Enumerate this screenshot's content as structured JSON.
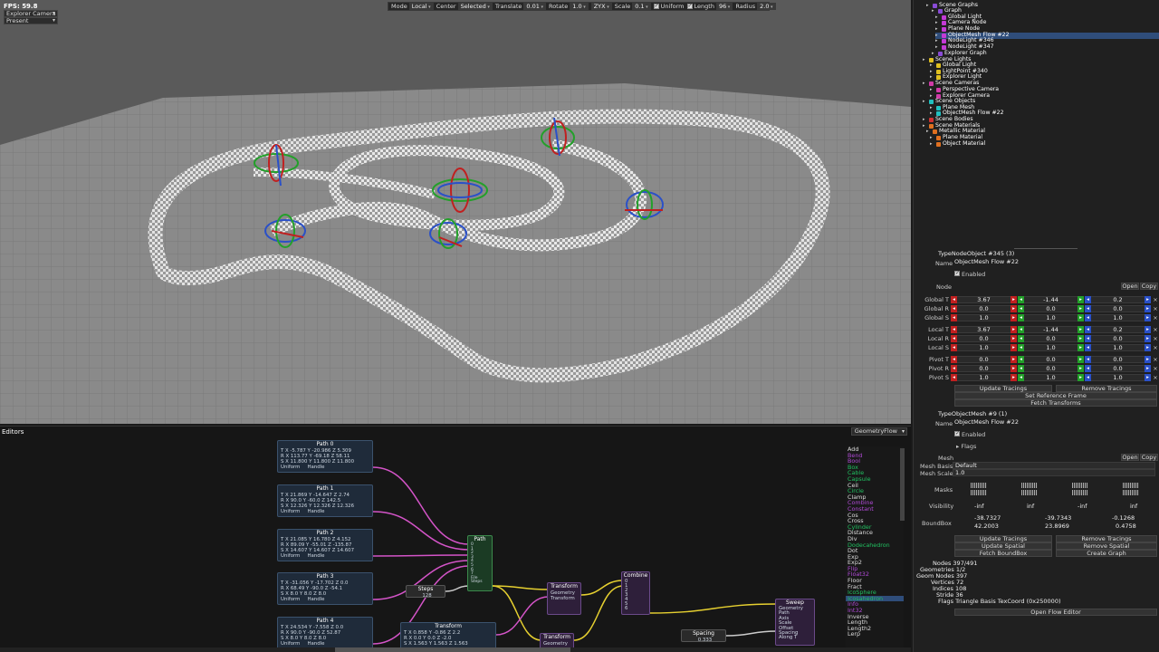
{
  "viewport": {
    "fps": "FPS: 59.8",
    "camera_select": "Explorer Camera",
    "mode_select": "Present",
    "toolbar": {
      "mode_label": "Mode",
      "mode_value": "Local",
      "center_label": "Center",
      "center_value": "Selected",
      "translate_label": "Translate",
      "translate_value": "0.01",
      "rotate_label": "Rotate",
      "rotate_value": "1.0",
      "order_value": "ZYX",
      "scale_label": "Scale",
      "scale_value": "0.1",
      "uniform_label": "Uniform",
      "length_label": "Length",
      "length_value": "96",
      "radius_label": "Radius",
      "radius_value": "2.0"
    }
  },
  "scene_tree": [
    {
      "label": "Scene Graphs",
      "icon": "graph-icon",
      "color": "#8a4bd6"
    },
    {
      "label": "Graph",
      "icon": "graph-icon",
      "color": "#8a4bd6"
    },
    {
      "label": "Global Light",
      "icon": "node-icon",
      "color": "#c43ad6"
    },
    {
      "label": "Camera Node",
      "icon": "node-icon",
      "color": "#c43ad6"
    },
    {
      "label": "Plane Node",
      "icon": "node-icon",
      "color": "#c43ad6"
    },
    {
      "label": "ObjectMesh Flow #22",
      "icon": "node-icon",
      "color": "#c43ad6",
      "selected": true
    },
    {
      "label": "NodeLight #346",
      "icon": "node-icon",
      "color": "#c43ad6"
    },
    {
      "label": "NodeLight #347",
      "icon": "node-icon",
      "color": "#c43ad6"
    },
    {
      "label": "Explorer Graph",
      "icon": "graph-icon",
      "color": "#8a4bd6"
    },
    {
      "label": "Scene Lights",
      "icon": "light-icon",
      "color": "#e0c020"
    },
    {
      "label": "Global Light",
      "icon": "light-icon",
      "color": "#e0c020"
    },
    {
      "label": "LightPoint #340",
      "icon": "light-icon",
      "color": "#e0c020"
    },
    {
      "label": "Explorer Light",
      "icon": "light-icon",
      "color": "#e0c020"
    },
    {
      "label": "Scene Cameras",
      "icon": "camera-icon",
      "color": "#d03aa8"
    },
    {
      "label": "Perspective Camera",
      "icon": "camera-icon",
      "color": "#d03aa8"
    },
    {
      "label": "Explorer Camera",
      "icon": "camera-icon",
      "color": "#d03aa8"
    },
    {
      "label": "Scene Objects",
      "icon": "object-icon",
      "color": "#20c0c0"
    },
    {
      "label": "Plane Mesh",
      "icon": "object-icon",
      "color": "#20c0c0"
    },
    {
      "label": "ObjectMesh Flow #22",
      "icon": "object-icon",
      "color": "#20c0c0"
    },
    {
      "label": "Scene Bodies",
      "icon": "body-icon",
      "color": "#d03030"
    },
    {
      "label": "Scene Materials",
      "icon": "material-icon",
      "color": "#e07020"
    },
    {
      "label": "Metallic Material",
      "icon": "material-icon",
      "color": "#e07020"
    },
    {
      "label": "Plane Material",
      "icon": "material-icon",
      "color": "#e07020"
    },
    {
      "label": "Object Material",
      "icon": "material-icon",
      "color": "#e07020"
    }
  ],
  "inspector": {
    "node_type": "TypeNodeObject #345 (3)",
    "name_label": "Name",
    "name_value": "ObjectMesh Flow #22",
    "enabled_label": "Enabled",
    "node_label": "Node",
    "open_label": "Open",
    "copy_label": "Copy",
    "transforms": [
      {
        "label": "Global T",
        "x": "3.67",
        "y": "-1.44",
        "z": "0.2"
      },
      {
        "label": "Global R",
        "x": "0.0",
        "y": "0.0",
        "z": "0.0"
      },
      {
        "label": "Global S",
        "x": "1.0",
        "y": "1.0",
        "z": "1.0"
      },
      {
        "label": "Local T",
        "x": "3.67",
        "y": "-1.44",
        "z": "0.2"
      },
      {
        "label": "Local R",
        "x": "0.0",
        "y": "0.0",
        "z": "0.0"
      },
      {
        "label": "Local S",
        "x": "1.0",
        "y": "1.0",
        "z": "1.0"
      },
      {
        "label": "Pivot T",
        "x": "0.0",
        "y": "0.0",
        "z": "0.0"
      },
      {
        "label": "Pivot R",
        "x": "0.0",
        "y": "0.0",
        "z": "0.0"
      },
      {
        "label": "Pivot S",
        "x": "1.0",
        "y": "1.0",
        "z": "1.0"
      }
    ],
    "update_tracings": "Update Tracings",
    "remove_tracings": "Remove Tracings",
    "set_reference_frame": "Set Reference Frame",
    "fetch_transforms": "Fetch Transforms",
    "mesh_type": "TypeObjectMesh #9 (1)",
    "mesh_name_value": "ObjectMesh Flow #22",
    "flags_label": "Flags",
    "mesh_label": "Mesh",
    "mesh_basis_label": "Mesh Basis",
    "mesh_basis_value": "Default",
    "mesh_scale_label": "Mesh Scale",
    "mesh_scale_value": "1.0",
    "masks_label": "Masks",
    "visibility_label": "Visibility",
    "visibility_values": [
      "-inf",
      "inf",
      "-inf",
      "inf"
    ],
    "boundbox_label": "BoundBox",
    "boundbox_min": [
      "-38.7327",
      "-39.7343",
      "-0.1268"
    ],
    "boundbox_max": [
      "42.2003",
      "23.8969",
      "0.4758"
    ],
    "update_spatial": "Update Spatial",
    "remove_spatial": "Remove Spatial",
    "fetch_boundbox": "Fetch BoundBox",
    "create_graph": "Create Graph",
    "stats": [
      "Nodes 397/491",
      "Geometries 1/2",
      "Geom Nodes 397",
      "Vertices 72",
      "Indices 108",
      "Stride 36",
      "Flags Triangle Basis TexCoord (0x250000)"
    ],
    "open_flow_editor": "Open Flow Editor"
  },
  "editors": {
    "title": "Editors",
    "tab": "GeometryFlow",
    "path_nodes": [
      {
        "title": "Path 0",
        "t": [
          "-5.787",
          "-20.986",
          "5.309"
        ],
        "r": [
          "113.77",
          "-69.18",
          "58.11"
        ],
        "s": [
          "11.800",
          "11.800",
          "11.800"
        ]
      },
      {
        "title": "Path 1",
        "t": [
          "21.869",
          "-14.647",
          "2.74"
        ],
        "r": [
          "90.0",
          "-60.0",
          "142.5"
        ],
        "s": [
          "12.326",
          "12.326",
          "12.326"
        ]
      },
      {
        "title": "Path 2",
        "t": [
          "21.085",
          "16.780",
          "4.152"
        ],
        "r": [
          "89.09",
          "-55.01",
          "-135.87"
        ],
        "s": [
          "14.607",
          "14.607",
          "14.607"
        ]
      },
      {
        "title": "Path 3",
        "t": [
          "-31.056",
          "-17.702",
          "0.0"
        ],
        "r": [
          "68.49",
          "-90.0",
          "-54.1"
        ],
        "s": [
          "8.0",
          "8.0",
          "8.0"
        ]
      },
      {
        "title": "Path 4",
        "t": [
          "24.534",
          "-7.558",
          "0.0"
        ],
        "r": [
          "90.0",
          "-90.0",
          "52.87"
        ],
        "s": [
          "8.0",
          "8.0",
          "8.0"
        ]
      }
    ],
    "uniform_label": "Uniform",
    "handle_label": "Handle",
    "path_node": {
      "title": "Path",
      "rows": [
        "0",
        "1",
        "2",
        "3",
        "4",
        "5",
        "6",
        "7",
        "File",
        "Steps"
      ]
    },
    "steps_node": {
      "title": "Steps",
      "value": "128"
    },
    "transform_node_a": {
      "title": "Transform",
      "rows": [
        "Geometry",
        "Transform"
      ]
    },
    "transform_node_b": {
      "title": "Transform",
      "rows": [
        "Geometry"
      ]
    },
    "transform_node_c": {
      "title": "Transform",
      "t": [
        "0.858",
        "-0.86",
        "2.2"
      ],
      "r": [
        "0.0",
        "0.0",
        "-2.0"
      ],
      "s": [
        "1.563",
        "1.563",
        "1.563"
      ]
    },
    "combine_node": {
      "title": "Combine",
      "rows": [
        "0",
        "1",
        "2",
        "3",
        "4",
        "5",
        "6"
      ]
    },
    "spacing_node": {
      "title": "Spacing",
      "value": "0.333"
    },
    "sweep_node": {
      "title": "Sweep",
      "rows": [
        "Geometry",
        "Path",
        "Axis",
        "Scale",
        "Offset",
        "Spacing",
        "Along T"
      ]
    },
    "library": [
      {
        "label": "Add",
        "color": "#dddddd"
      },
      {
        "label": "Bend",
        "color": "#b04ad6"
      },
      {
        "label": "Bool",
        "color": "#b04ad6"
      },
      {
        "label": "Box",
        "color": "#20c060"
      },
      {
        "label": "Cable",
        "color": "#20c060"
      },
      {
        "label": "Capsule",
        "color": "#20c060"
      },
      {
        "label": "Ceil",
        "color": "#dddddd"
      },
      {
        "label": "Circle",
        "color": "#20c060"
      },
      {
        "label": "Clamp",
        "color": "#dddddd"
      },
      {
        "label": "Combine",
        "color": "#b04ad6"
      },
      {
        "label": "Constant",
        "color": "#b04ad6"
      },
      {
        "label": "Cos",
        "color": "#dddddd"
      },
      {
        "label": "Cross",
        "color": "#dddddd"
      },
      {
        "label": "Cylinder",
        "color": "#20c060"
      },
      {
        "label": "Distance",
        "color": "#dddddd"
      },
      {
        "label": "Div",
        "color": "#dddddd"
      },
      {
        "label": "Dodecahedron",
        "color": "#20c060"
      },
      {
        "label": "Dot",
        "color": "#dddddd"
      },
      {
        "label": "Exp",
        "color": "#dddddd"
      },
      {
        "label": "Exp2",
        "color": "#dddddd"
      },
      {
        "label": "Flip",
        "color": "#b04ad6"
      },
      {
        "label": "Float32",
        "color": "#b04ad6"
      },
      {
        "label": "Floor",
        "color": "#dddddd"
      },
      {
        "label": "Fract",
        "color": "#dddddd"
      },
      {
        "label": "IcoSphere",
        "color": "#20c060"
      },
      {
        "label": "Icosahedron",
        "color": "#20c060",
        "selected": true
      },
      {
        "label": "Info",
        "color": "#b04ad6"
      },
      {
        "label": "Int32",
        "color": "#b04ad6"
      },
      {
        "label": "Inverse",
        "color": "#dddddd"
      },
      {
        "label": "Length",
        "color": "#dddddd"
      },
      {
        "label": "Length2",
        "color": "#dddddd"
      },
      {
        "label": "Lerp",
        "color": "#dddddd"
      }
    ]
  }
}
